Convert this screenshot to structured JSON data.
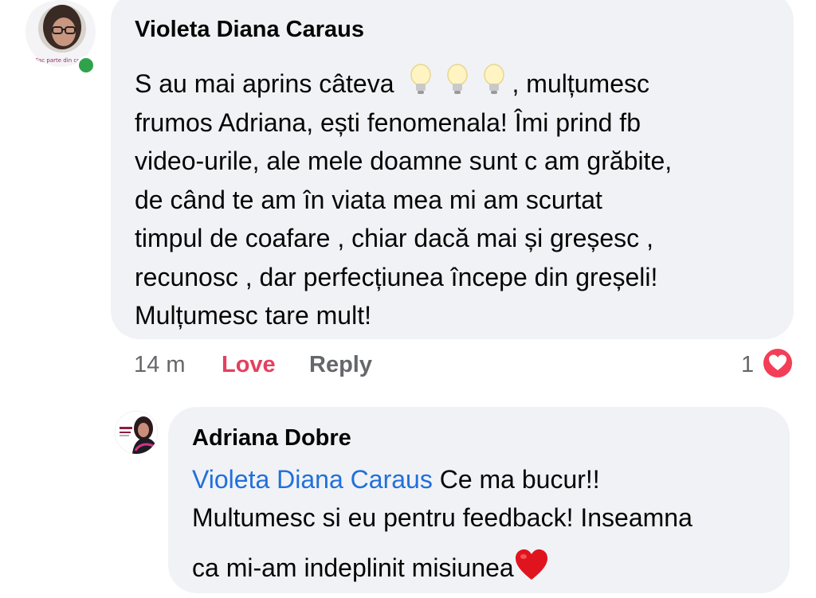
{
  "comment": {
    "author": "Violeta Diana Caraus",
    "avatar_caption": "Fac parte din com",
    "lines": [
      "S au mai aprins câteva",
      ", mulțumesc",
      "frumos  Adriana,  ești fenomenala!    Îmi prind fb",
      "video-urile,   ale mele doamne sunt c am grăbite,",
      "de când  te am în viata mea  mi am scurtat",
      "timpul de coafare , chiar dacă mai și greșesc  ,",
      "recunosc , dar perfecțiunea începe din greșeli!",
      "Mulțumesc  tare mult!"
    ],
    "bulb_icons": [
      "lightbulb-icon",
      "lightbulb-icon",
      "lightbulb-icon"
    ],
    "time": "14 m",
    "love_label": "Love",
    "reply_label": "Reply",
    "reaction_count": "1",
    "reaction_icon": "heart-reaction-icon"
  },
  "reply": {
    "author": "Adriana Dobre",
    "mention": "Violeta Diana Caraus",
    "line1_rest": " Ce ma bucur!!",
    "line2": "Multumesc si eu pentru feedback! Inseamna",
    "line3": "ca mi-am indeplinit misiunea",
    "emoji": "red-heart-emoji"
  },
  "colors": {
    "bubble": "#f0f2f5",
    "love": "#e4405f",
    "mention": "#216fdb",
    "meta": "#65676b",
    "online": "#31a24c"
  }
}
